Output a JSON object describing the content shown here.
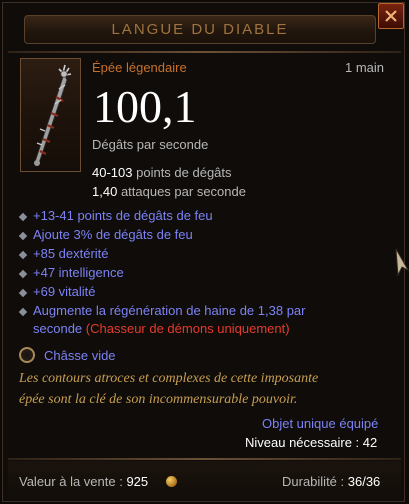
{
  "item": {
    "name": "LANGUE DU DIABLE",
    "type": "Épée légendaire",
    "slot": "1 main",
    "dps": "100,1",
    "dps_label": "Dégâts par seconde",
    "damage_value": "40-103",
    "damage_label": "points de dégâts",
    "speed_value": "1,40",
    "speed_label": "attaques par seconde",
    "affixes": [
      "+13-41 points de dégâts de feu",
      "Ajoute 3% de dégâts de feu",
      "+85 dextérité",
      "+47 intelligence",
      "+69 vitalité",
      "Augmente la régénération de haine de 1,38 par"
    ],
    "affix_wrap": "seconde",
    "class_restriction": "(Chasseur de démons uniquement)",
    "socket": "Châsse vide",
    "flavor_line1": "Les contours atroces et complexes de cette imposante",
    "flavor_line2": "épée sont la clé de son incommensurable pouvoir.",
    "unique_equipped": "Objet unique équipé",
    "required_level": "Niveau nécessaire : 42",
    "sell_label": "Valeur à la vente : ",
    "sell_value": "925",
    "durability_label": "Durabilité : ",
    "durability_value": "36/36"
  },
  "icons": {
    "close": "close-x-icon",
    "item": "sword-icon",
    "coin": "gold-coin-icon",
    "socket": "empty-socket-icon",
    "cursor": "mouse-cursor-icon"
  },
  "colors": {
    "name": "#a0733e",
    "legendary": "#c8712a",
    "magic": "#7c83f4",
    "restriction": "#e53b2d",
    "flavor": "#c89f52"
  }
}
